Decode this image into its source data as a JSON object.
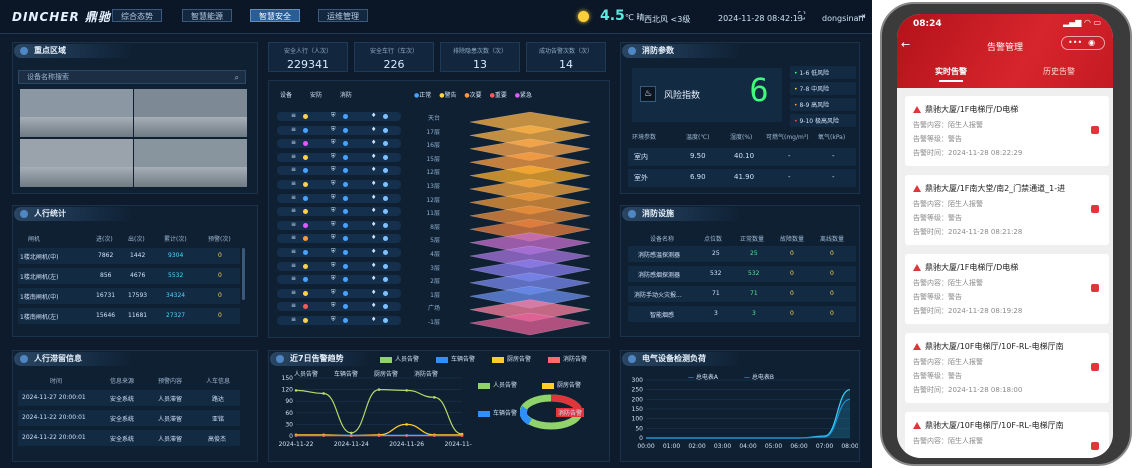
{
  "dash": {
    "logo": "DINCHER 鼎驰",
    "nav": [
      "综合态势",
      "智慧能源",
      "智慧安全",
      "运维管理"
    ],
    "weather": {
      "temp": "4.5",
      "unit": "℃",
      "cond": "晴",
      "wind": "西北风",
      "level": "<3级"
    },
    "datetime": "2024-11-28 08:42:13",
    "user": "dongsinan",
    "key_area": {
      "title": "重点区域",
      "search_placeholder": "设备名称搜索"
    },
    "traffic": {
      "title": "人行统计",
      "headers": [
        "闸机",
        "进(次)",
        "出(次)",
        "累计(次)",
        "预警(次)"
      ],
      "rows": [
        [
          "1楼北闸机(中)",
          "7862",
          "1442",
          "9304",
          "0"
        ],
        [
          "1楼北闸机(左)",
          "856",
          "4676",
          "5532",
          "0"
        ],
        [
          "1楼南闸机(中)",
          "16731",
          "17593",
          "34324",
          "0"
        ],
        [
          "1楼南闸机(左)",
          "15646",
          "11681",
          "27327",
          "0"
        ]
      ]
    },
    "detain": {
      "title": "人行滞留信息",
      "headers": [
        "时间",
        "信息来源",
        "预警内容",
        "人车信息"
      ],
      "rows": [
        [
          "2024-11-27 20:00:01",
          "安全系统",
          "人员滞留",
          "路达"
        ],
        [
          "2024-11-22 20:00:01",
          "安全系统",
          "人员滞留",
          "亚铭"
        ],
        [
          "2024-11-22 20:00:01",
          "安全系统",
          "人员滞留",
          "高俊杰"
        ]
      ]
    },
    "stats": [
      {
        "label": "安全人行（人次）",
        "value": "229341"
      },
      {
        "label": "安全车行（车次）",
        "value": "226"
      },
      {
        "label": "排除隐患次数（次）",
        "value": "13"
      },
      {
        "label": "成功告警次数（次）",
        "value": "14"
      }
    ],
    "floor_tabs": [
      "设备",
      "安防",
      "消防"
    ],
    "status_legend": [
      "正常",
      "警告",
      "次要",
      "重要",
      "紧急"
    ],
    "floors": [
      "天台",
      "17层",
      "16层",
      "15层",
      "12层",
      "13层",
      "12层",
      "11层",
      "8层",
      "5层",
      "4层",
      "3层",
      "2层",
      "1层",
      "广场",
      "-1层"
    ],
    "trend": {
      "title": "近7日告警趋势",
      "legend": [
        "人员告警",
        "车辆告警",
        "厨房告警",
        "消防告警"
      ],
      "xticks": [
        "2024-11-22",
        "2024-11-24",
        "2024-11-26",
        "2024-11-28"
      ],
      "yticks": [
        "150",
        "120",
        "90",
        "60",
        "30",
        "0"
      ]
    },
    "pie_legend": [
      "人员告警",
      "厨房告警",
      "车辆告警",
      "消防告警"
    ],
    "fire_params": {
      "title": "消防参数",
      "risk_label": "风险指数",
      "risk_value": "6",
      "levels": [
        "1-6 低风险",
        "7-8 中风险",
        "8-9 高风险",
        "9-10 极高风险"
      ],
      "headers": [
        "环境参数",
        "温度(℃)",
        "湿度(%)",
        "可燃气(mg/m³)",
        "氧气(kPa)"
      ],
      "rows": [
        [
          "室内",
          "9.50",
          "40.10",
          "-",
          "-"
        ],
        [
          "室外",
          "6.90",
          "41.90",
          "-",
          "-"
        ]
      ]
    },
    "fire_fac": {
      "title": "消防设施",
      "headers": [
        "设备名称",
        "点位数",
        "正常数量",
        "故障数量",
        "离线数量"
      ],
      "rows": [
        [
          "消防感温探测器",
          "25",
          "25",
          "0",
          "0"
        ],
        [
          "消防感烟探测器",
          "532",
          "532",
          "0",
          "0"
        ],
        [
          "消防手动火灾报...",
          "71",
          "71",
          "0",
          "0"
        ],
        [
          "智能烟感",
          "3",
          "3",
          "0",
          "0"
        ]
      ]
    },
    "elec": {
      "title": "电气设备检测负荷",
      "legend": [
        "总电表A",
        "总电表B"
      ],
      "yticks": [
        "300",
        "250",
        "200",
        "150",
        "100",
        "50",
        "0"
      ],
      "xticks": [
        "00:00",
        "01:00",
        "02:00",
        "03:00",
        "04:00",
        "05:00",
        "06:00",
        "07:00",
        "08:00"
      ]
    }
  },
  "chart_data": [
    {
      "type": "line",
      "title": "近7日告警趋势",
      "x": [
        "2024-11-22",
        "2024-11-23",
        "2024-11-24",
        "2024-11-25",
        "2024-11-26",
        "2024-11-27",
        "2024-11-28"
      ],
      "ylim": [
        0,
        150
      ],
      "series": [
        {
          "name": "人员告警",
          "values": [
            118,
            110,
            8,
            120,
            118,
            100,
            5
          ]
        },
        {
          "name": "车辆告警",
          "values": [
            2,
            2,
            2,
            2,
            2,
            2,
            2
          ]
        },
        {
          "name": "厨房告警",
          "values": [
            3,
            3,
            1,
            3,
            30,
            3,
            3
          ]
        },
        {
          "name": "消防告警",
          "values": [
            1,
            1,
            1,
            1,
            1,
            1,
            1
          ]
        }
      ]
    },
    {
      "type": "line",
      "title": "电气设备检测负荷",
      "x": [
        "00:00",
        "01:00",
        "02:00",
        "03:00",
        "04:00",
        "05:00",
        "06:00",
        "07:00",
        "08:00"
      ],
      "ylim": [
        0,
        300
      ],
      "series": [
        {
          "name": "总电表A",
          "values": [
            0,
            0,
            0,
            0,
            0,
            0,
            0,
            10,
            250
          ]
        },
        {
          "name": "总电表B",
          "values": [
            0,
            0,
            0,
            0,
            0,
            0,
            0,
            5,
            200
          ]
        }
      ]
    }
  ],
  "phone": {
    "time": "08:24",
    "title": "告警管理",
    "tabs": [
      "实时告警",
      "历史告警"
    ],
    "alarms": [
      {
        "name": "鼎驰大厦/1F电梯厅/D电梯",
        "content": "告警内容：陌生人报警",
        "level": "告警等级：警告",
        "time": "告警时间：2024-11-28 08:22:29"
      },
      {
        "name": "鼎驰大厦/1F南大堂/南2_门禁通道_1-进",
        "content": "告警内容：陌生人报警",
        "level": "告警等级：警告",
        "time": "告警时间：2024-11-28 08:21:28"
      },
      {
        "name": "鼎驰大厦/1F电梯厅/D电梯",
        "content": "告警内容：陌生人报警",
        "level": "告警等级：警告",
        "time": "告警时间：2024-11-28 08:19:28"
      },
      {
        "name": "鼎驰大厦/10F电梯厅/10F-RL-电梯厅南",
        "content": "告警内容：陌生人报警",
        "level": "告警等级：警告",
        "time": "告警时间：2024-11-28 08:18:00"
      },
      {
        "name": "鼎驰大厦/10F电梯厅/10F-RL-电梯厅南",
        "content": "告警内容：陌生人报警",
        "level": "",
        "time": ""
      }
    ]
  }
}
